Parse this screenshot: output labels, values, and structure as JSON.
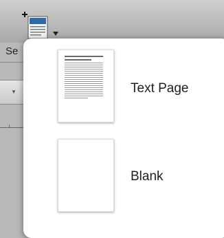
{
  "toolbar": {
    "label_partial": "Se",
    "insert_button_icon": "new-page-icon"
  },
  "popover": {
    "items": [
      {
        "label": "Text Page",
        "thumbnail": "text-page-thumbnail-icon"
      },
      {
        "label": "Blank",
        "thumbnail": "blank-page-thumbnail-icon"
      }
    ]
  }
}
